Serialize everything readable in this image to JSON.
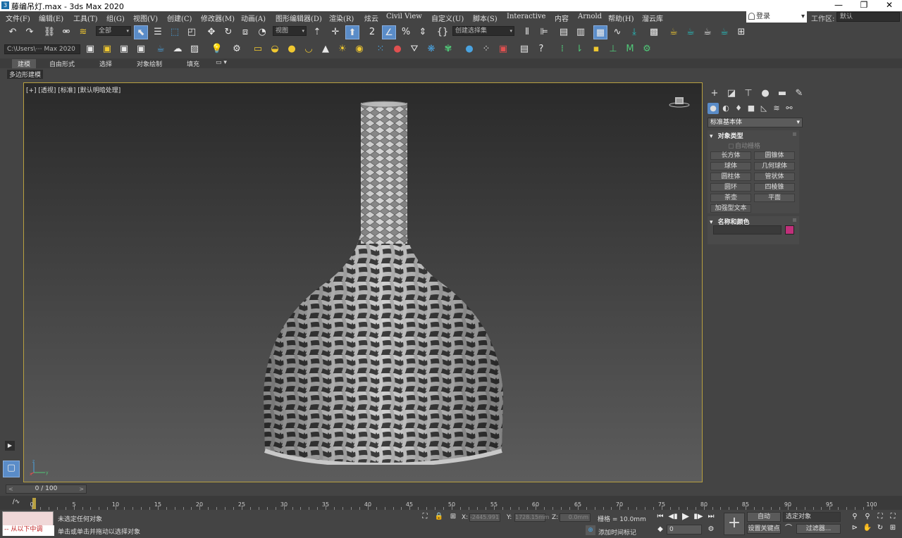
{
  "window": {
    "title": "藤编吊灯.max - 3ds Max 2020",
    "app_icon": "3",
    "minimize": "—",
    "maximize": "❐",
    "close": "✕"
  },
  "menu": [
    {
      "label": "文件(F)"
    },
    {
      "label": "编辑(E)"
    },
    {
      "label": "工具(T)"
    },
    {
      "label": "组(G)"
    },
    {
      "label": "视图(V)"
    },
    {
      "label": "创建(C)"
    },
    {
      "label": "修改器(M)"
    },
    {
      "label": "动画(A)"
    },
    {
      "label": "图形编辑器(D)"
    },
    {
      "label": "渲染(R)"
    },
    {
      "label": "炫云"
    },
    {
      "label": "Civil View"
    },
    {
      "label": "自定义(U)"
    },
    {
      "label": "脚本(S)"
    },
    {
      "label": "Interactive"
    },
    {
      "label": "内容"
    },
    {
      "label": "Arnold"
    },
    {
      "label": "帮助(H)"
    },
    {
      "label": "溜云库"
    }
  ],
  "login": {
    "label": "登录",
    "arrow": "▾"
  },
  "workspace": {
    "label": "工作区:",
    "value": "默认"
  },
  "toolbar1": {
    "selection_filter": "全部",
    "ref_coord": "视图",
    "named_selection": "创建选择集",
    "dd_arrow": "▾"
  },
  "toolbar2": {
    "path": "C:\\Users\\⋯ Max 2020"
  },
  "ribbon": {
    "tabs": [
      {
        "label": "建模"
      },
      {
        "label": "自由形式"
      },
      {
        "label": "选择"
      },
      {
        "label": "对象绘制"
      },
      {
        "label": "填充"
      }
    ],
    "extra": "▭ ▾",
    "sublabel": "多边形建模"
  },
  "viewport": {
    "label": "[+] [透视] [标准] [默认明暗处理]",
    "axis_x": "x",
    "axis_y": "y",
    "axis_z": "z"
  },
  "command_panel": {
    "primitive_type": "标准基本体",
    "dd_arrow": "▾",
    "object_type": {
      "title": "对象类型",
      "collapse": "▾",
      "autogrid": "自动栅格",
      "buttons": [
        "长方体",
        "圆锥体",
        "球体",
        "几何球体",
        "圆柱体",
        "管状体",
        "圆环",
        "四棱锥",
        "茶壶",
        "平面",
        "加强型文本"
      ]
    },
    "name_color": {
      "title": "名称和颜色",
      "collapse": "▾",
      "color": "#c0307a"
    }
  },
  "time": {
    "slider": "0 / 100",
    "prev": "<",
    "next": ">",
    "ticks": [
      "0",
      "5",
      "10",
      "15",
      "20",
      "25",
      "30",
      "35",
      "40",
      "45",
      "50",
      "55",
      "60",
      "65",
      "70",
      "75",
      "80",
      "85",
      "90",
      "95",
      "100"
    ]
  },
  "status": {
    "maxscript_line": "-- 从以下中调",
    "selection": "未选定任何对象",
    "prompt": "单击或单击并拖动以选择对象",
    "x_label": "X:",
    "x": "-2445.991",
    "y_label": "Y:",
    "y": "1728.15mm",
    "z_label": "Z:",
    "z": "0.0mm",
    "grid": "栅格 = 10.0mm",
    "add_time_tag": "添加时间标记",
    "auto_key": "自动",
    "selected_object": "选定对象",
    "set_key": "设置关键点",
    "filters": "过滤器...",
    "frame": "0"
  }
}
